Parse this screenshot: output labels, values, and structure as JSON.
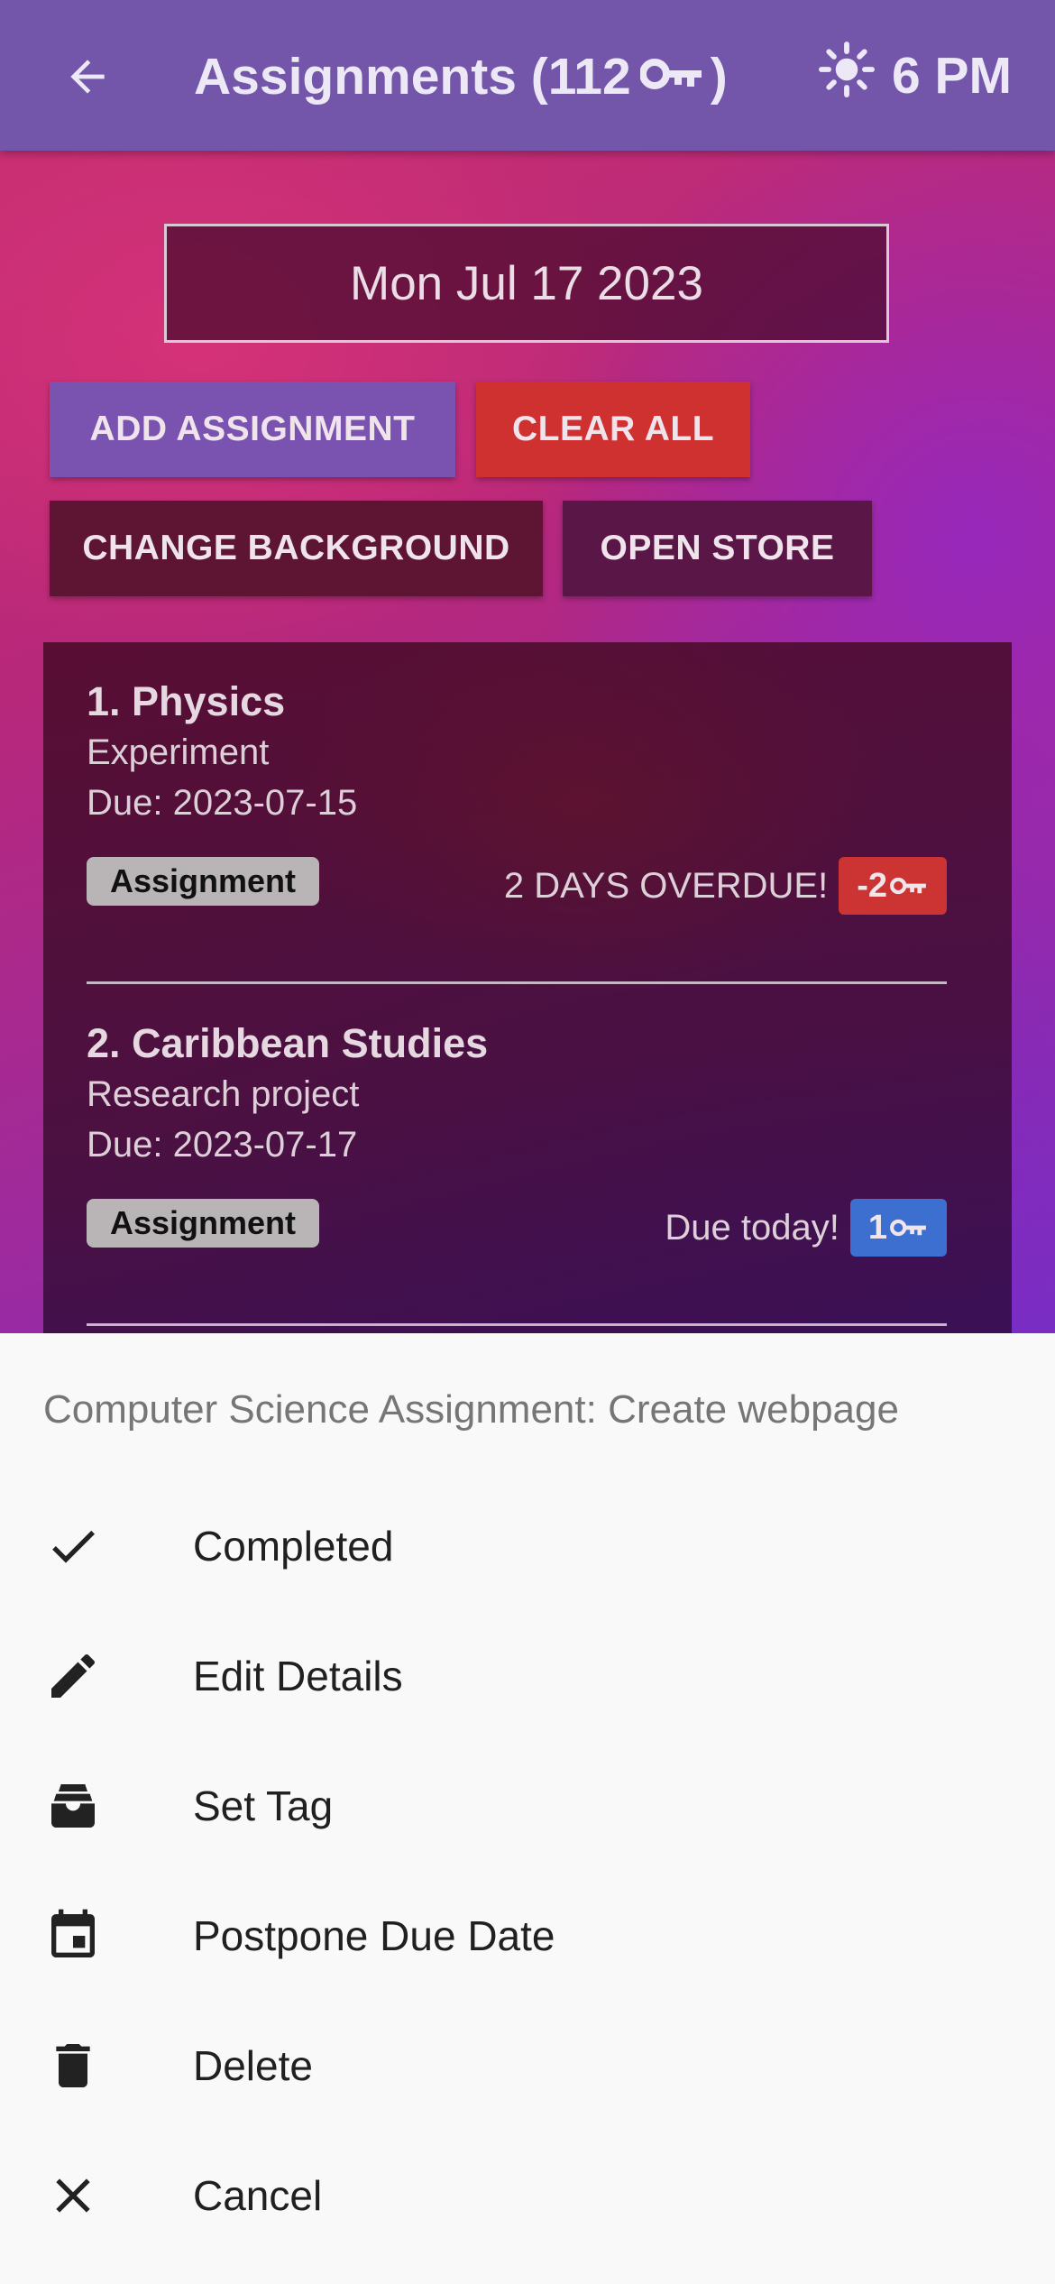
{
  "app_bar": {
    "title": "Assignments (112",
    "title_suffix": ")",
    "weather_time": "6 PM"
  },
  "date": "Mon Jul 17 2023",
  "buttons": {
    "add": "ADD ASSIGNMENT",
    "clear": "CLEAR ALL",
    "change_bg": "CHANGE BACKGROUND",
    "store": "OPEN STORE"
  },
  "colors": {
    "app_bar": "#7356a9",
    "add_button": "#7a52b0",
    "clear_button": "#cf3030",
    "overdue_badge": "#cc3333",
    "today_badge": "#3d6fd0"
  },
  "assignments": [
    {
      "name": "1. Physics",
      "description": "Experiment",
      "due": "Due: 2023-07-15",
      "tag": "Assignment",
      "status": "2 DAYS OVERDUE!",
      "keys": "-2",
      "badge_color": "red"
    },
    {
      "name": "2. Caribbean Studies",
      "description": "Research project",
      "due": "Due: 2023-07-17",
      "tag": "Assignment",
      "status": "Due today!",
      "keys": "1",
      "badge_color": "blue"
    }
  ],
  "sheet": {
    "title": "Computer Science Assignment: Create webpage",
    "items": [
      {
        "label": "Completed",
        "icon": "check-icon"
      },
      {
        "label": "Edit Details",
        "icon": "pencil-icon"
      },
      {
        "label": "Set Tag",
        "icon": "inbox-tray-icon"
      },
      {
        "label": "Postpone Due Date",
        "icon": "calendar-icon"
      },
      {
        "label": "Delete",
        "icon": "trash-icon"
      },
      {
        "label": "Cancel",
        "icon": "close-icon"
      }
    ]
  }
}
